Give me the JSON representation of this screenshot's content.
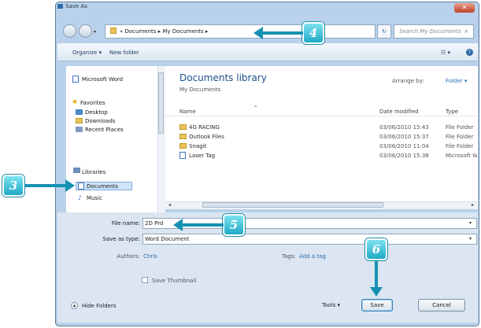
{
  "window": {
    "title": "Save As",
    "close_label": "✕"
  },
  "address_bar": {
    "path": "« Documents ▸ My Documents ▸",
    "refresh_label": "↻",
    "search_placeholder": "Search My Documents"
  },
  "toolbar": {
    "organize": "Organize ▾",
    "new_folder": "New folder",
    "views": "☷ ▾",
    "help": "?"
  },
  "nav_pane": {
    "top_item": "Microsoft Word",
    "favorites_header": "Favorites",
    "favorites": [
      "Desktop",
      "Downloads",
      "Recent Places"
    ],
    "libraries_header": "Libraries",
    "libraries": [
      "Documents",
      "Music"
    ]
  },
  "library": {
    "title": "Documents library",
    "subtitle": "My Documents",
    "arrange_label": "Arrange by:",
    "arrange_value": "Folder ▾"
  },
  "columns": [
    "Name",
    "Date modified",
    "Type"
  ],
  "files": [
    {
      "name": "4G RACING",
      "date": "03/06/2010 15:43",
      "type": "File Folder",
      "icon": "folder-icon"
    },
    {
      "name": "Outlook Files",
      "date": "03/06/2010 15:37",
      "type": "File Folder",
      "icon": "folder-icon"
    },
    {
      "name": "Snagit",
      "date": "03/06/2010 11:04",
      "type": "File Folder",
      "icon": "folder-icon"
    },
    {
      "name": "Laser Tag",
      "date": "03/06/2010 15:38",
      "type": "Microsoft Word",
      "icon": "word-document-icon"
    }
  ],
  "form": {
    "file_name_label": "File name:",
    "file_name_value": "2D Prd",
    "save_type_label": "Save as type:",
    "save_type_value": "Word Document",
    "authors_label": "Authors:",
    "authors_value": "Chris",
    "tags_label": "Tags:",
    "tags_value": "Add a tag",
    "thumbnail_label": "Save Thumbnail",
    "hide_folders": "Hide Folders",
    "tools": "Tools ▾",
    "save": "Save",
    "cancel": "Cancel"
  },
  "callouts": [
    "3",
    "4",
    "5",
    "6"
  ],
  "colors": {
    "callout": "#1ea9c7",
    "arrow": "#1592b3",
    "library_title": "#1e4e8c",
    "link": "#2b6cb0"
  }
}
